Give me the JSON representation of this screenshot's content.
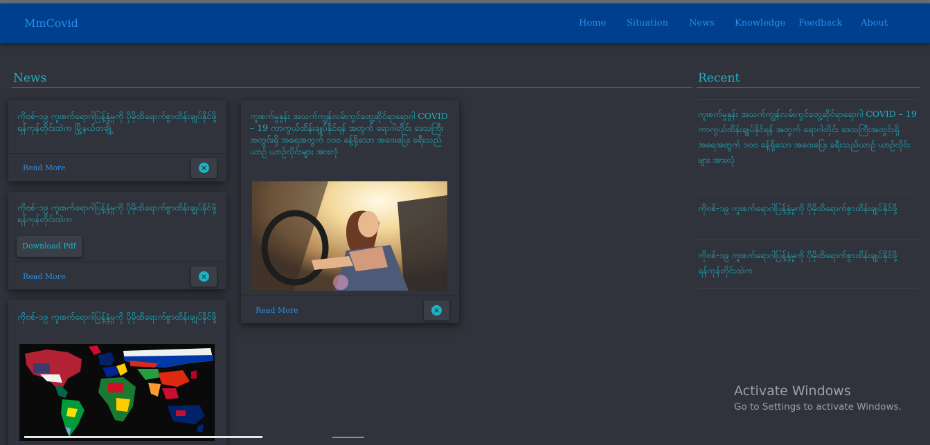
{
  "brand": "MmCovid",
  "nav": [
    "Home",
    "Situation",
    "News",
    "Knowledge",
    "Feedback",
    "About"
  ],
  "news_title": "News",
  "recent_title": "Recent",
  "cards": [
    {
      "text": "ကိုဗစ်-၁၉ ကူးစက်ရောဂါပြန့်နှံ့မှုကို ပိုမိုထိရောက်စွာထိန်းချုပ်နိုင်ဖို့ ရန်ကုန်တိုင်းထဲက မြို့နယ်တချို့",
      "read_more": "Read More",
      "close": "×"
    },
    {
      "text": "ကိုဗစ်-၁၉ ကူးစက်ရောဂါပြန့်နှံ့မှုကို ပိုမိုထိရောက်စွာထိန်းချုပ်နိုင်ဖို့ ရန်ကုန်တိုင်းထဲက",
      "pdf": "Download Pdf",
      "read_more": "Read More",
      "close": "×"
    },
    {
      "text": "ကိုဗစ်-၁၉ ကူးစက်ရောဂါပြန့်နှံ့မှုကို ပိုမိုထိရောက်စွာထိန်းချုပ်နိုင်ဖို့"
    },
    {
      "text": "ကူးစက်မှုနှုန်း အသက်ကျွန်လမ်းကွင်တွေ့ဆိုင်ရာရောဂါ COVID – 19 ကာကွယ်ထိန်းချုပ်နိုင်ရန် အတွက် ရောဂါတိုင်း ဒေသကြီးအတွင်းရှိ အရေအတွက် ၁၀၀ ခန့်ရှိသော အဝေးပြေး ခရီးသည်ယာဉ် ယာဉ်လိုင်းများ အားလုံ",
      "read_more": "Read More",
      "close": "×"
    }
  ],
  "recent": [
    "ကူးစက်မှုနှုန်း အသက်ကျွန်လမ်းကွင်တွေ့ဆိုင်ရာရောဂါ COVID – 19 ကာကွယ်ထိန်းချုပ်နိုင်ရန် အတွက် ရောဂါတိုင်း ဒေသကြီးအတွင်းရှိ အရေအတွက် ၁၀၀ ခန့်ရှိသော အဝေးပြေး ခရီးသည်ယာဉ် ယာဉ်လိုင်းများ အားလုံ",
    "ကိုဗစ်-၁၉ ကူးစက်ရောဂါပြန့်နှံ့မှုကို ပိုမိုထိရောက်စွာထိန်းချုပ်နိုင်ဖို့",
    "ကိုဗစ်-၁၉ ကူးစက်ရောဂါပြန့်နှံ့မှုကို ပိုမိုထိရောက်စွာထိန်းချုပ်နိုင်ဖို့ ရန်ကုန်တိုင်းထဲက"
  ],
  "watermark": {
    "title": "Activate Windows",
    "sub": "Go to Settings to activate Windows."
  },
  "colors": {
    "navbar": "#003f8e",
    "link": "#2a8ee8",
    "accent": "#1eb3c4",
    "background": "#30333b"
  }
}
